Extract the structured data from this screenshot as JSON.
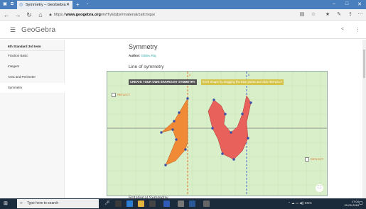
{
  "browser": {
    "tab_title": "Symmetry – GeoGebra",
    "url_prefix": "https://www.geogebra.org/",
    "url_domain": "www.geogebra.org",
    "url_path": "m/fTyEbjbx#material/zafcmqse"
  },
  "app": {
    "brand": "GeoGebra"
  },
  "sidebar": {
    "heading": "6th Standard 3rd term",
    "items": [
      {
        "label": "Fraction Basic"
      },
      {
        "label": "Integers"
      },
      {
        "label": "Area and Perimeter"
      },
      {
        "label": "Symmetry"
      }
    ]
  },
  "main": {
    "title": "Symmetry",
    "author_label": "Author:",
    "author_name": "Gildeu Raj",
    "section_title": "Line of symmetry",
    "next_section": "Rotational Symmetry"
  },
  "applet": {
    "create_button": "CREATE YOUR OWN SHAPES BY SYMMETRY",
    "edit_note": "EDIT Shape by dragging the Blue points and click REFLECT",
    "reflect_left": "REFLECT",
    "reflect_right": "REFLECT",
    "line_label_left": "a",
    "line_label_right": "b"
  },
  "taskbar": {
    "search_placeholder": "Type here to search",
    "lang": "ENG",
    "time": "17:04",
    "date": "20-09-2018"
  },
  "colors": {
    "brand_blue": "#4a7fbe",
    "applet_bg": "#d9efc9",
    "shape_orange": "#f08a36",
    "shape_red": "#e8615a",
    "axis_orange": "#e07a2a",
    "axis_blue": "#4a6bd1"
  }
}
